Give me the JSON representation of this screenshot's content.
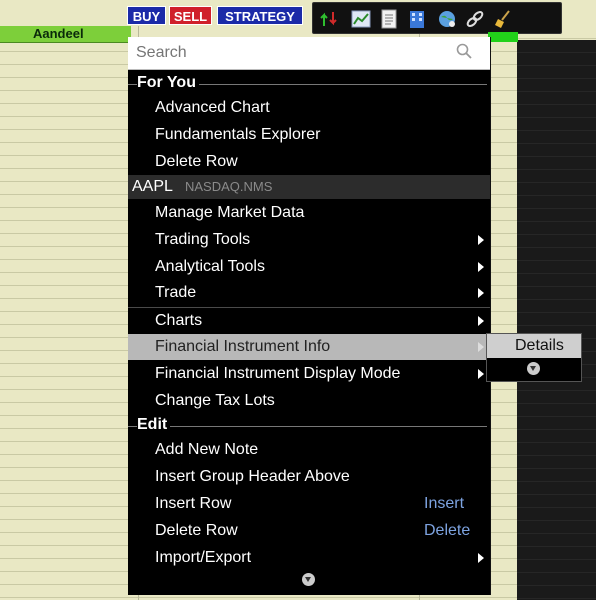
{
  "header": {
    "column_label": "Aandeel",
    "buy_label": "BUY",
    "sell_label": "SELL",
    "strategy_label": "STRATEGY"
  },
  "toolbar_icons": [
    "green-arrows-icon",
    "chart-icon",
    "document-icon",
    "building-icon",
    "globe-icon",
    "link-icon",
    "broom-icon"
  ],
  "search": {
    "placeholder": "Search"
  },
  "menu": {
    "for_you_title": "For You",
    "for_you_items": [
      "Advanced Chart",
      "Fundamentals Explorer",
      "Delete Row"
    ],
    "symbol": "AAPL",
    "exchange": "NASDAQ.NMS",
    "symbol_items": [
      {
        "label": "Manage Market Data",
        "submenu": false
      },
      {
        "label": "Trading Tools",
        "submenu": true
      },
      {
        "label": "Analytical Tools",
        "submenu": true
      },
      {
        "label": "Trade",
        "submenu": true
      },
      {
        "label": "Charts",
        "submenu": true
      },
      {
        "label": "Financial Instrument Info",
        "submenu": true,
        "highlighted": true
      },
      {
        "label": "Financial Instrument Display Mode",
        "submenu": true
      },
      {
        "label": "Change Tax Lots",
        "submenu": false
      }
    ],
    "edit_title": "Edit",
    "edit_items": [
      {
        "label": "Add New Note",
        "shortcut": ""
      },
      {
        "label": "Insert Group Header Above",
        "shortcut": ""
      },
      {
        "label": "Insert Row",
        "shortcut": "Insert"
      },
      {
        "label": "Delete Row",
        "shortcut": "Delete"
      },
      {
        "label": "Import/Export",
        "shortcut": "",
        "submenu": true
      }
    ]
  },
  "submenu": {
    "details_label": "Details"
  },
  "colors": {
    "accent_highlight": "#b8b8b8",
    "buy": "#1b2aa8",
    "sell": "#d0202a",
    "header_green": "#7dcf3a",
    "shortcut": "#7da3e0"
  }
}
